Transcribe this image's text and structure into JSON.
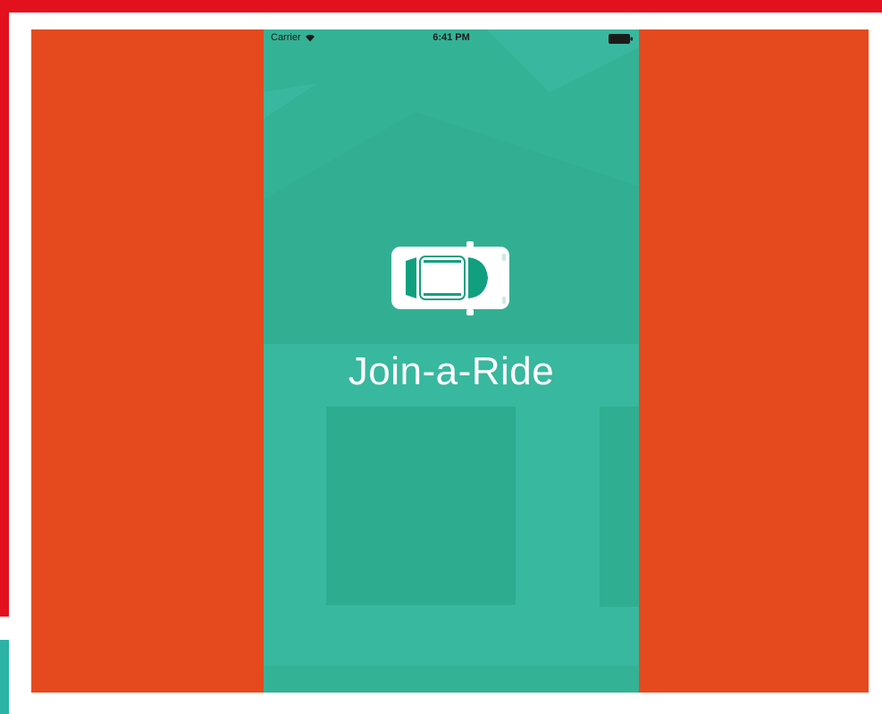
{
  "status_bar": {
    "carrier": "Carrier",
    "time": "6:41 PM",
    "wifi_icon": "wifi-icon",
    "battery_icon": "battery-icon"
  },
  "splash": {
    "app_title": "Join-a-Ride",
    "logo_icon": "car-top-view-icon"
  },
  "colors": {
    "slide_background": "#e44a1d",
    "frame_accent": "#e3101e",
    "phone_background": "#38b89e",
    "map_block": "#2eac8f",
    "car_window": "#11a07f"
  }
}
